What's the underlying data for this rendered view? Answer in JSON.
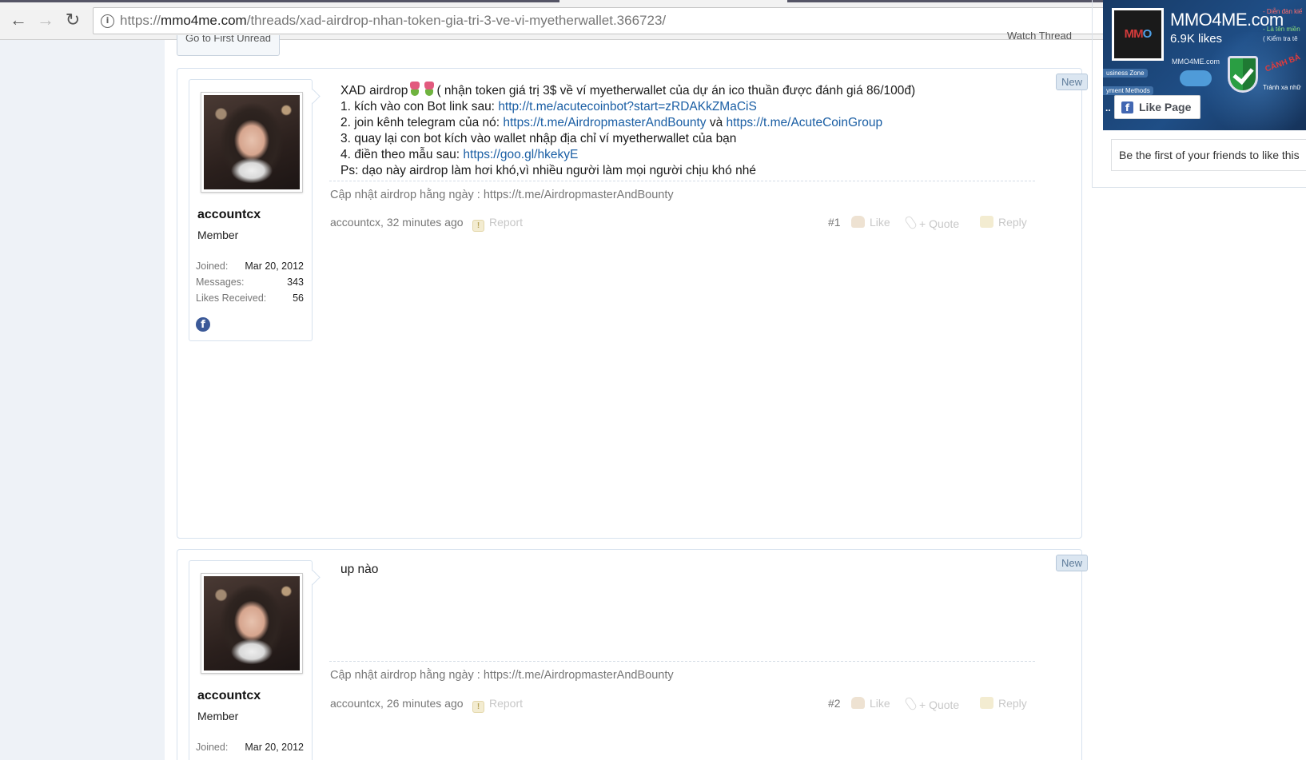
{
  "browser": {
    "url_scheme": "https://",
    "url_host": "mmo4me.com",
    "url_path": "/threads/xad-airdrop-nhan-token-gia-tri-3-ve-vi-myetherwallet.366723/",
    "back_icon": "arrow-left-icon",
    "forward_icon": "arrow-right-icon",
    "reload_icon": "reload-icon",
    "info_icon": "info-icon"
  },
  "thread_nav": {
    "first_unread": "Go to First Unread",
    "watch_thread": "Watch Thread"
  },
  "posts": [
    {
      "username": "accountcx",
      "user_title": "Member",
      "stats": [
        {
          "label": "Joined:",
          "value": "Mar 20, 2012"
        },
        {
          "label": "Messages:",
          "value": "343"
        },
        {
          "label": "Likes Received:",
          "value": "56"
        }
      ],
      "badge": "New",
      "message": {
        "line1_pre": "XAD airdrop",
        "line1_post": "( nhận token giá trị 3$ về ví myetherwallet của dự án ico thuần được đánh giá 86/100đ)",
        "line2_pre": "1. kích vào con Bot link sau: ",
        "line2_link": "http://t.me/acutecoinbot?start=zRDAKkZMaCiS",
        "line3_pre": "2. join kênh telegram của nó: ",
        "line3_link1": "https://t.me/AirdropmasterAndBounty",
        "line3_mid": " và ",
        "line3_link2": "https://t.me/AcuteCoinGroup",
        "line4": "3. quay lại con bot kích vào wallet nhập địa chỉ ví myetherwallet của bạn",
        "line5_pre": "4. điền theo mẫu sau: ",
        "line5_link": "https://goo.gl/hkekyE",
        "line6": "Ps: dạo này airdrop làm hơi khó,vì nhiều người làm mọi người chịu khó nhé"
      },
      "signature": "Cập nhật airdrop hằng ngày : https://t.me/AirdropmasterAndBounty",
      "meta": {
        "author_time": "accountcx, 32 minutes ago",
        "report": "Report",
        "number": "#1",
        "like": "Like",
        "quote": "+ Quote",
        "reply": "Reply"
      }
    },
    {
      "username": "accountcx",
      "user_title": "Member",
      "stats": [
        {
          "label": "Joined:",
          "value": "Mar 20, 2012"
        }
      ],
      "badge": "New",
      "message": {
        "text": "up nào"
      },
      "signature": "Cập nhật airdrop hằng ngày : https://t.me/AirdropmasterAndBounty",
      "meta": {
        "author_time": "accountcx, 26 minutes ago",
        "report": "Report",
        "number": "#2",
        "like": "Like",
        "quote": "+ Quote",
        "reply": "Reply"
      }
    }
  ],
  "fb_widget": {
    "page_name": "MMO4ME.com",
    "likes": "6.9K likes",
    "logo_text_a": "MM",
    "logo_text_b": "O",
    "banner_site": "MMO4ME.com",
    "banner_tag1": "usiness Zone",
    "banner_tag2": "yment Methods",
    "banner_red": "- Diễn đàn kiế",
    "banner_green": "- Là tên miền",
    "banner_white": "( Kiểm tra tê",
    "banner_warn": "CẢNH BÁ",
    "banner_tranh": "Tránh xa nhữ",
    "like_button": "Like Page",
    "friends_text": "Be the first of your friends to like this"
  }
}
